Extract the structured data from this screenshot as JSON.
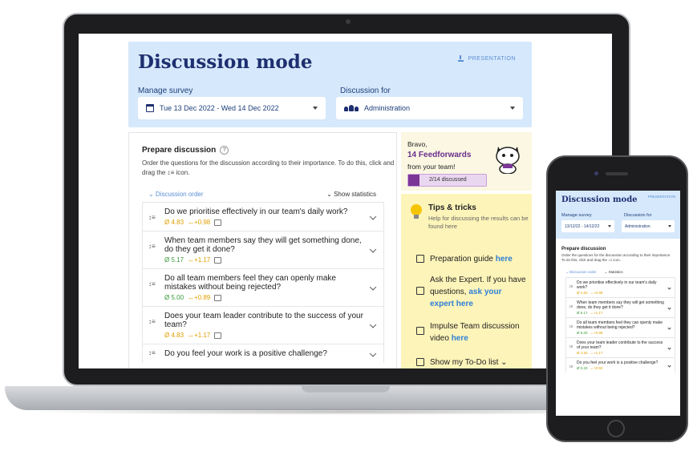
{
  "app": {
    "title": "Discussion mode",
    "presentation_label": "PRESENTATION",
    "manage_survey_label": "Manage survey",
    "manage_survey_value": "Tue 13 Dec 2022 - Wed 14 Dec 2022",
    "discussion_for_label": "Discussion for",
    "discussion_for_value": "Administration",
    "prepare_title": "Prepare discussion",
    "prepare_desc": "Order the questions for the discussion according to their importance. To do this, click and drag the ↕≡ icon.",
    "discussion_order": "⌄ Discussion order",
    "show_statistics": "⌄ Show statistics",
    "drag_glyph": "↕≡",
    "questions": [
      {
        "text": "Do we prioritise effectively in our team's daily work?",
        "score": "Ø 4.83",
        "delta": "↔+0.98",
        "color": "#e0a100"
      },
      {
        "text": "When team members say they will get something done, do they get it done?",
        "score": "Ø 5.17",
        "delta": "↔+1.17",
        "color": "#3a9a3a"
      },
      {
        "text": "Do all team members feel they can openly make mistakes without being rejected?",
        "score": "Ø 5.00",
        "delta": "↔+0.89",
        "color": "#3a9a3a"
      },
      {
        "text": "Does your team leader contribute to the success of your team?",
        "score": "Ø 4.83",
        "delta": "↔+1.17",
        "color": "#e0a100"
      },
      {
        "text": "Do you feel your work is a positive challenge?",
        "score": "",
        "delta": "",
        "color": "#3a9a3a"
      }
    ],
    "bravo": "Bravo,",
    "feedforwards": "14 Feedforwards",
    "from_team": "from your team!",
    "progress_label": "2/14 discussed",
    "progress_fraction": 0.143,
    "tips_title": "Tips & tricks",
    "tips_sub": "Help for discussing the results can be found here",
    "tip1_text": "Preparation guide ",
    "tip1_link": "here",
    "tip2_text": "Ask the Expert. If you have questions, ",
    "tip2_link": "ask your expert here",
    "tip3_text": "Impulse Team discussion video ",
    "tip3_link": "here",
    "tip4_text": "Show my To-Do list ⌄"
  },
  "phone": {
    "title": "Discussion mode",
    "presentation_label": "PRESENTATION",
    "manage_survey_label": "Manage survey",
    "manage_survey_value": "13/12/22 - 14/12/22",
    "discussion_for_label": "Discussion for",
    "discussion_for_value": "Administration",
    "prepare_title": "Prepare discussion",
    "prepare_desc": "Order the questions for the discussion according to their importance. To do this, click and drag the ↕≡ icon.",
    "discussion_order": "⌄ Discussion order",
    "show_statistics": "⌄ Statistics",
    "questions": [
      {
        "text": "Do we prioritise effectively in our team's daily work?",
        "score": "Ø 4.83",
        "delta": "↔+0.98",
        "color": "#e0a100"
      },
      {
        "text": "When team members say they will get something done, do they get it done?",
        "score": "Ø 5.17",
        "delta": "↔+1.17",
        "color": "#3a9a3a"
      },
      {
        "text": "Do all team members feel they can openly make mistakes without being rejected?",
        "score": "Ø 5.00",
        "delta": "↔+0.89",
        "color": "#3a9a3a"
      },
      {
        "text": "Does your team leader contribute to the success of your team?",
        "score": "Ø 4.83",
        "delta": "↔+1.17",
        "color": "#e0a100"
      },
      {
        "text": "Do you feel your work is a positive challenge?",
        "score": "Ø 5.33",
        "delta": "↔+0.92",
        "color": "#3a9a3a"
      }
    ]
  }
}
